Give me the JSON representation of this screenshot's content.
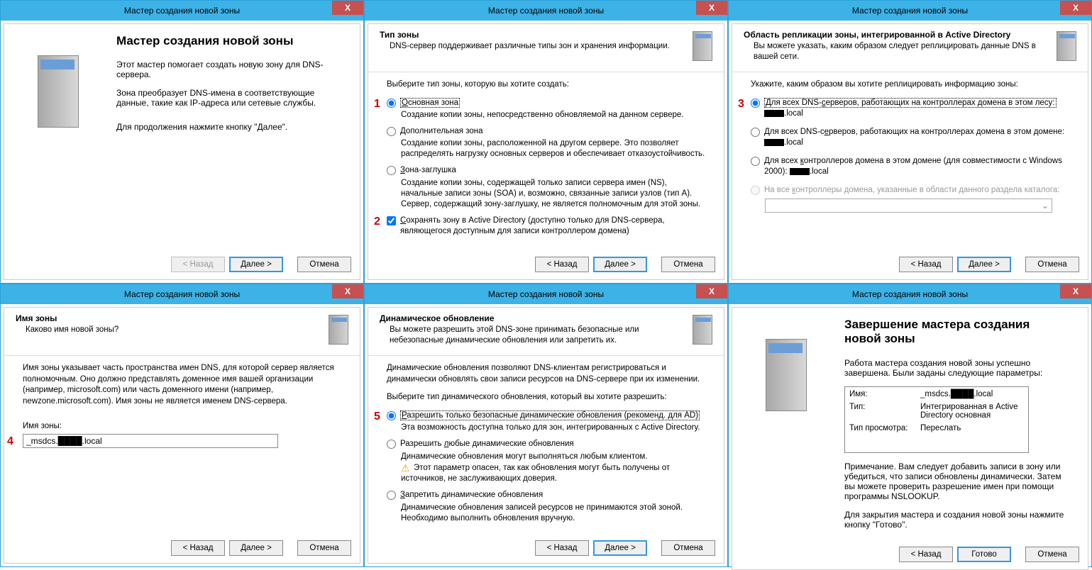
{
  "common": {
    "title": "Мастер создания новой зоны",
    "close": "X",
    "back": "< Назад",
    "next": "Далее >",
    "cancel": "Отмена",
    "finish": "Готово"
  },
  "w1": {
    "heading": "Мастер создания новой зоны",
    "p1": "Этот мастер помогает создать новую зону для DNS-сервера.",
    "p2": "Зона преобразует DNS-имена в соответствующие данные, такие как IP-адреса или сетевые службы.",
    "p3": "Для продолжения нажмите кнопку \"Далее\"."
  },
  "w2": {
    "title": "Тип зоны",
    "sub": "DNS-сервер поддерживает различные типы зон и хранения информации.",
    "instr": "Выберите тип зоны, которую вы хотите создать:",
    "o1": "Основная зона",
    "o1d": "Создание копии зоны, непосредственно обновляемой на данном сервере.",
    "o2": "Дополнительная зона",
    "o2d": "Создание копии зоны, расположенной на другом сервере. Это позволяет распределять нагрузку основных серверов и обеспечивает отказоустойчивость.",
    "o3": "Зона-заглушка",
    "o3d": "Создание копии зоны, содержащей только записи сервера имен (NS), начальные записи зоны (SOA) и, возможно, связанные записи узлов (тип A). Сервер, содержащий зону-заглушку, не является полномочным для этой зоны.",
    "chk": "Сохранять зону в Active Directory (доступно только для DNS-сервера, являющегося доступным для записи контроллером домена)",
    "badge1": "1",
    "badge2": "2"
  },
  "w3": {
    "title": "Область репликации зоны, интегрированной в Active Directory",
    "sub": "Вы можете указать, каким образом следует реплицировать данные DNS в вашей сети.",
    "instr": "Укажите, каким образом вы хотите реплицировать информацию зоны:",
    "o1a": "Для всех DNS-серверов, работающих на контроллерах домена в этом лесу:",
    "o1b": ".local",
    "o2a": "Для всех DNS-серверов, работающих на контроллерах домена в этом домене:",
    "o2b": ".local",
    "o3a": "Для всех контроллеров домена в этом домене (для совместимости с Windows 2000): ",
    "o3b": ".local",
    "o4": "На все контроллеры домена, указанные в области данного раздела каталога:",
    "badge": "3"
  },
  "w4": {
    "title": "Имя зоны",
    "sub": "Каково имя новой зоны?",
    "instr": "Имя зоны указывает часть пространства имен DNS, для которой сервер является полномочным. Оно должно представлять доменное имя вашей организации (например, microsoft.com) или часть доменного имени (например, newzone.microsoft.com). Имя зоны не является именем DNS-сервера.",
    "label": "Имя зоны:",
    "value": "_msdcs.████.local",
    "badge": "4"
  },
  "w5": {
    "title": "Динамическое обновление",
    "sub": "Вы можете разрешить этой DNS-зоне принимать безопасные или небезопасные динамические обновления или запретить их.",
    "p1": "Динамические обновления позволяют DNS-клиентам регистрироваться и динамически обновлять свои записи ресурсов на DNS-сервере при их изменении.",
    "p2": "Выберите тип динамического обновления, который вы хотите разрешить:",
    "o1": "Разрешить только безопасные динамические обновления (рекоменд. для AD)",
    "o1d": "Эта возможность доступна только для зон, интегрированных с Active Directory.",
    "o2": "Разрешить любые динамические обновления",
    "o2d": "Динамические обновления могут выполняться любым клиентом.",
    "o2w": "Этот параметр опасен, так как обновления могут быть получены от источников, не заслуживающих доверия.",
    "o3": "Запретить динамические обновления",
    "o3d": "Динамические обновления записей ресурсов не принимаются этой зоной. Необходимо выполнить обновления вручную.",
    "badge": "5"
  },
  "w6": {
    "heading": "Завершение мастера создания новой зоны",
    "p1": "Работа мастера создания новой зоны успешно завершена. Были заданы следующие параметры:",
    "s_name_l": "Имя:",
    "s_name_v": "_msdcs.████.local",
    "s_type_l": "Тип:",
    "s_type_v": "Интегрированная в Active Directory основная",
    "s_look_l": "Тип просмотра:",
    "s_look_v": "Переслать",
    "p2": "Примечание. Вам следует добавить записи в зону или убедиться, что записи обновлены динамически. Затем вы можете проверить разрешение имен при помощи программы NSLOOKUP.",
    "p3": "Для закрытия мастера и создания новой зоны нажмите кнопку \"Готово\"."
  }
}
